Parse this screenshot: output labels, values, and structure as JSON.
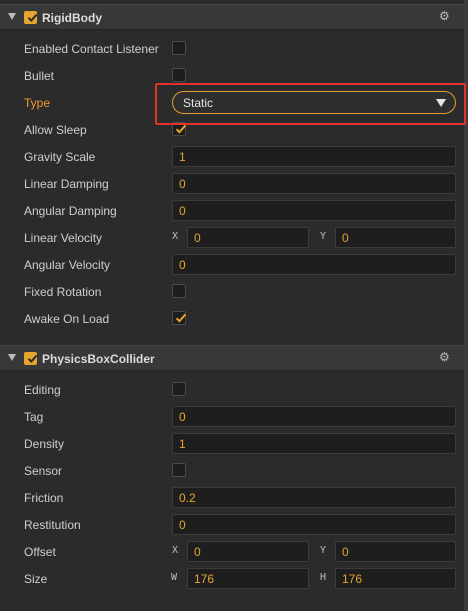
{
  "rigidbody": {
    "title": "RigidBody",
    "gear_icon": "gear-icon",
    "rows": {
      "enabled_contact_listener": "Enabled Contact Listener",
      "bullet": "Bullet",
      "type": "Type",
      "type_value": "Static",
      "allow_sleep": "Allow Sleep",
      "gravity_scale": "Gravity Scale",
      "gravity_scale_value": "1",
      "linear_damping": "Linear Damping",
      "linear_damping_value": "0",
      "angular_damping": "Angular Damping",
      "angular_damping_value": "0",
      "linear_velocity": "Linear Velocity",
      "linear_velocity_x_label": "X",
      "linear_velocity_x": "0",
      "linear_velocity_y_label": "Y",
      "linear_velocity_y": "0",
      "angular_velocity": "Angular Velocity",
      "angular_velocity_value": "0",
      "fixed_rotation": "Fixed Rotation",
      "awake_on_load": "Awake On Load"
    },
    "checked": {
      "enabled_contact_listener": false,
      "bullet": false,
      "allow_sleep": true,
      "fixed_rotation": false,
      "awake_on_load": true
    }
  },
  "collider": {
    "title": "PhysicsBoxCollider",
    "gear_icon": "gear-icon",
    "rows": {
      "editing": "Editing",
      "tag": "Tag",
      "tag_value": "0",
      "density": "Density",
      "density_value": "1",
      "sensor": "Sensor",
      "friction": "Friction",
      "friction_value": "0.2",
      "restitution": "Restitution",
      "restitution_value": "0",
      "offset": "Offset",
      "offset_x_label": "X",
      "offset_x": "0",
      "offset_y_label": "Y",
      "offset_y": "0",
      "size": "Size",
      "size_w_label": "W",
      "size_w": "176",
      "size_h_label": "H",
      "size_h": "176"
    },
    "checked": {
      "editing": false,
      "sensor": false
    }
  },
  "colors": {
    "accent": "#e5a52e",
    "label_highlight": "#ef9a2e",
    "annotation_box": "#e2322c",
    "panel_bg": "#2b2b2b"
  }
}
